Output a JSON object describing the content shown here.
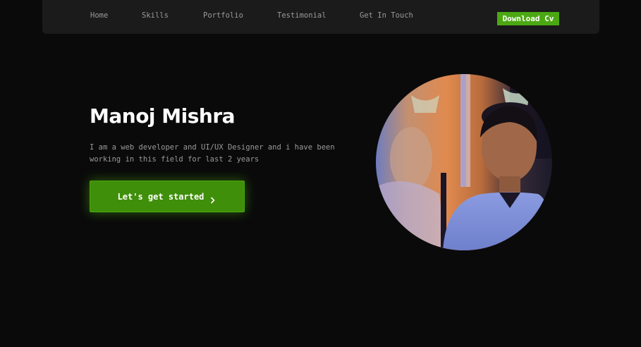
{
  "nav": {
    "items": [
      {
        "label": "Home"
      },
      {
        "label": "Skills"
      },
      {
        "label": "Portfolio"
      },
      {
        "label": "Testimonial"
      },
      {
        "label": "Get In Touch"
      }
    ],
    "download_label": "Download Cv"
  },
  "hero": {
    "name": "Manoj Mishra",
    "description": "I am a web developer and UI/UX Designer and i have been working in this field for last 2 years",
    "cta_label": "Let's get started",
    "cta_icon": "chevron-right-icon"
  },
  "portrait": {
    "icon": "profile-photo"
  },
  "colors": {
    "background": "#0a0a0a",
    "navbar": "#1b1b1b",
    "accent": "#4ca812",
    "cta": "#3f8f0a",
    "muted_text": "#9a9a9a"
  }
}
